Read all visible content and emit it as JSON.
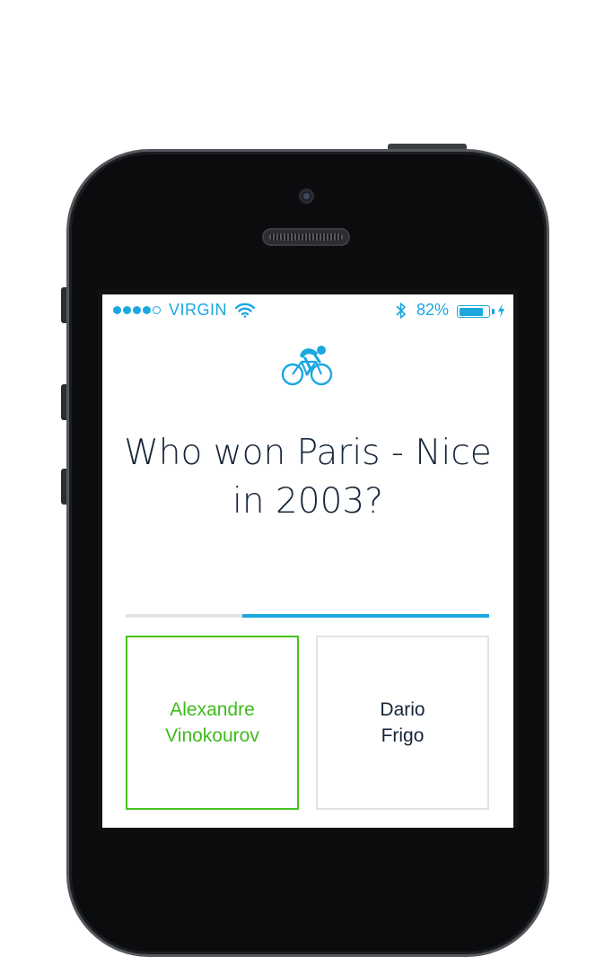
{
  "status_bar": {
    "carrier": "VIRGIN",
    "signal_bars_filled": 4,
    "signal_bars_total": 5,
    "battery_percent_label": "82%",
    "battery_level": 0.82,
    "icons": [
      "signal-dots-icon",
      "wifi-icon",
      "bluetooth-icon",
      "battery-icon",
      "charging-bolt-icon"
    ],
    "color": "#1ba7e0"
  },
  "app": {
    "logo_icon": "cyclist-icon",
    "question": "Who won Paris - Nice in 2003?",
    "progress_fraction": 0.68,
    "answers": [
      {
        "line1": "Alexandre",
        "line2": "Vinokourov",
        "state": "selected-correct"
      },
      {
        "line1": "Dario",
        "line2": "Frigo",
        "state": "unselected"
      }
    ],
    "colors": {
      "accent": "#1ba7e0",
      "correct": "#3dbb1a",
      "text": "#16263a",
      "border": "#e2e2e2"
    }
  }
}
